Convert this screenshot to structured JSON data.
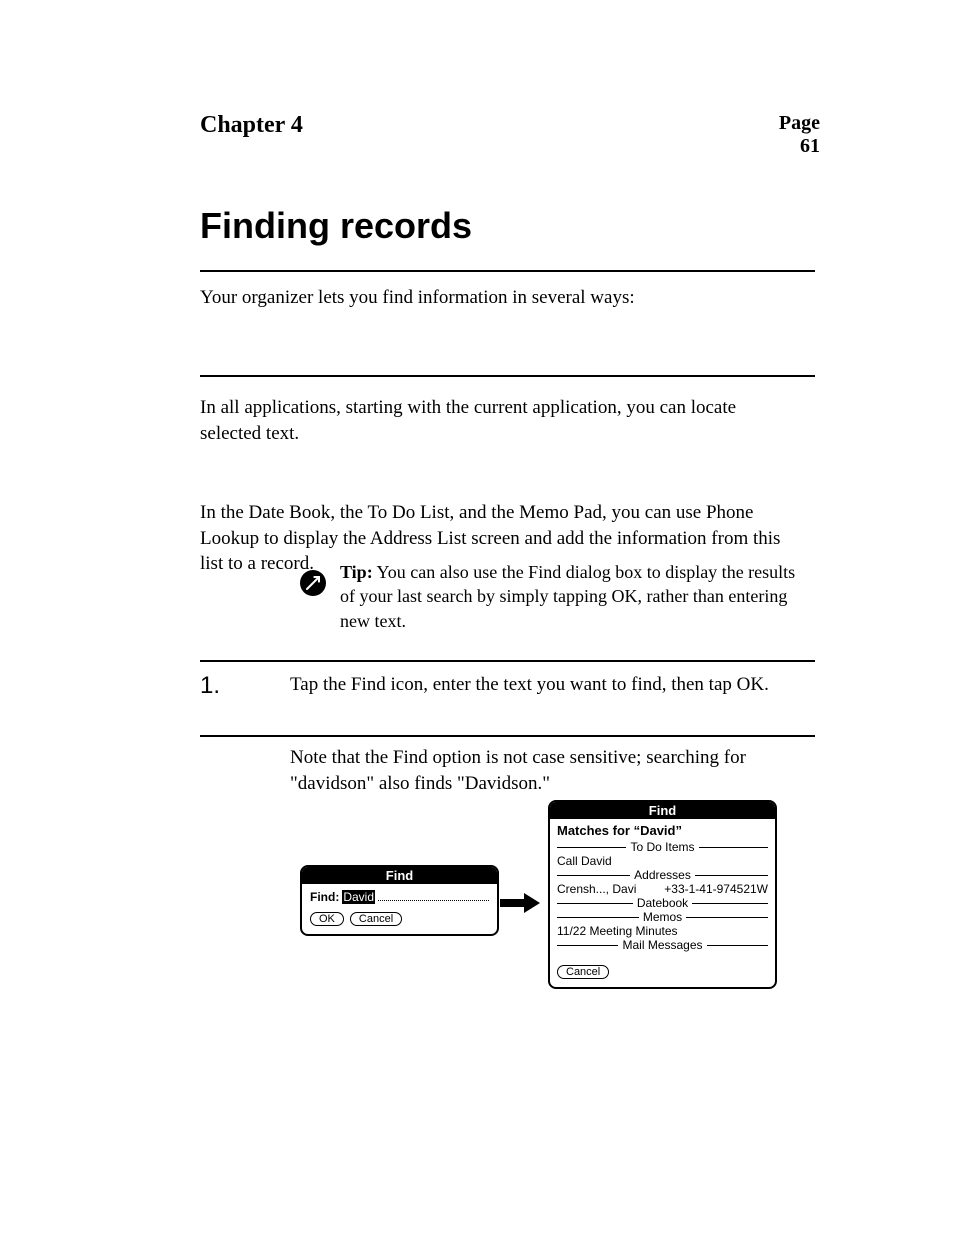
{
  "header": {
    "chapter": "Chapter 4",
    "page": "Page 61"
  },
  "section_title": "Finding records",
  "paragraphs": {
    "intro1": "Your organizer lets you find information in several ways:",
    "intro2": "In all applications, starting with the current application, you can locate selected text.",
    "intro3": "In the Date Book, the To Do List, and the Memo Pad, you can use Phone Lookup to display the Address List screen and add the information from this list to a record.",
    "tip_label": "Tip:",
    "tip_body": "You can also use the Find dialog box to display the results of your last search by simply tapping OK, rather than entering new text.",
    "step1": "Tap the Find icon, enter the text you want to find, then tap OK.",
    "sub1": "Note that the Find option is not case sensitive; searching for \"davidson\" also finds \"Davidson.\""
  },
  "step_number": "1.",
  "find_dialog": {
    "title": "Find",
    "label": "Find:",
    "value": "David",
    "ok": "OK",
    "cancel": "Cancel"
  },
  "results_dialog": {
    "title": "Find",
    "matches": "Matches for “David”",
    "sections": {
      "todo": "To Do Items",
      "addresses": "Addresses",
      "datebook": "Datebook",
      "memos": "Memos",
      "mail": "Mail Messages"
    },
    "todo_item": "Call David",
    "addr_name": "Crensh..., Davi",
    "addr_phone": "+33-1-41-974521W",
    "memo_item": "11/22 Meeting Minutes",
    "cancel": "Cancel"
  }
}
